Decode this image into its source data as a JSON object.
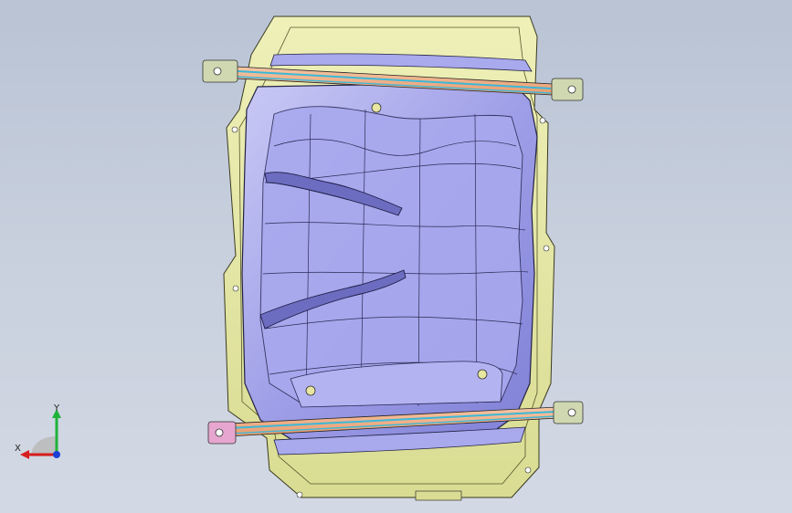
{
  "viewport": {
    "background_top": "#b9c3d4",
    "background_bottom": "#d3d9e4"
  },
  "model": {
    "flange_color": "#e4e7a6",
    "pan_color": "#9b9be6",
    "strap_color": "#f0b089",
    "strap_edge_color": "#3bb8d8",
    "bracket_color": "#cfd8b0",
    "bracket_pink_color": "#e6a6cf"
  },
  "triad": {
    "x_label": "X",
    "y_label": "Y",
    "x_color": "#d81e1e",
    "y_color": "#1fb33a",
    "z_color": "#1c3fd6"
  }
}
